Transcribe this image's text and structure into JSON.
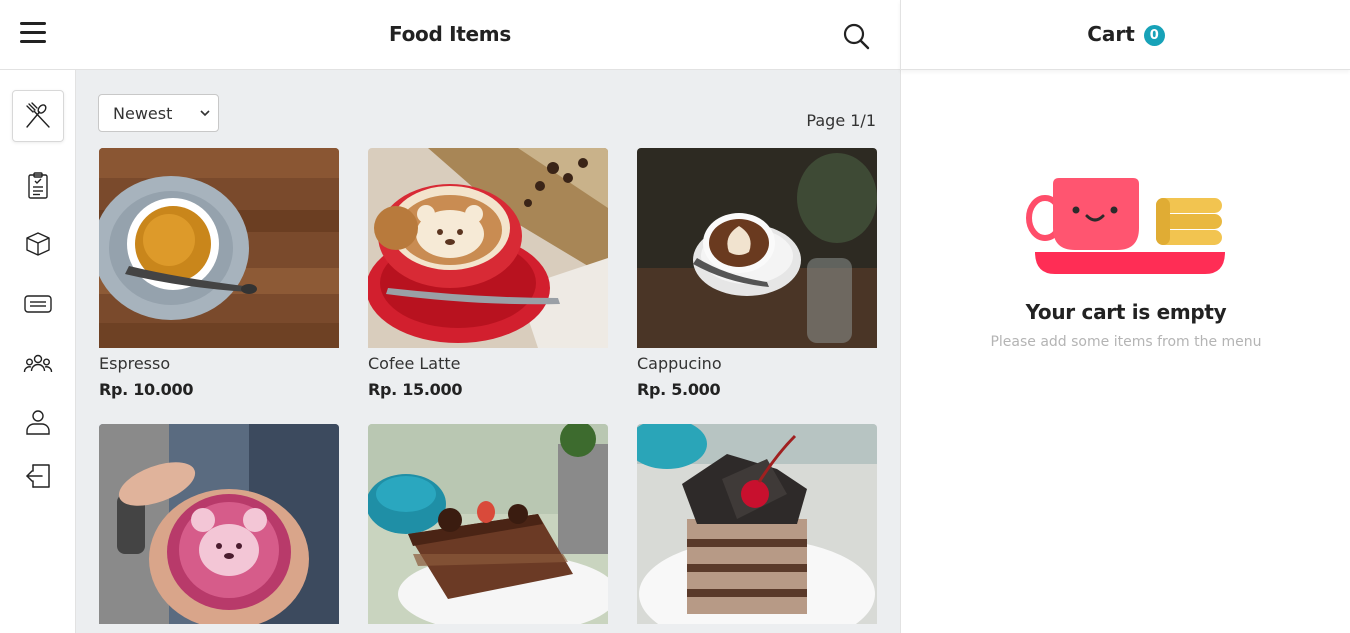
{
  "header": {
    "title": "Food Items",
    "menu_icon": "hamburger-icon",
    "search_icon": "search-icon"
  },
  "cart_header": {
    "title": "Cart",
    "count": "0",
    "badge_color": "#17a2b8"
  },
  "sidebar": {
    "items": [
      {
        "icon": "utensils-icon",
        "active": true
      },
      {
        "icon": "clipboard-icon",
        "active": false
      },
      {
        "icon": "box-icon",
        "active": false
      },
      {
        "icon": "card-icon",
        "active": false
      },
      {
        "icon": "users-icon",
        "active": false
      },
      {
        "icon": "user-icon",
        "active": false
      },
      {
        "icon": "logout-icon",
        "active": false
      }
    ]
  },
  "toolbar": {
    "sort_value": "Newest",
    "page_info": "Page 1/1"
  },
  "products": [
    {
      "name": "Espresso",
      "price": "Rp. 10.000"
    },
    {
      "name": "Cofee Latte",
      "price": "Rp. 15.000"
    },
    {
      "name": "Cappucino",
      "price": "Rp. 5.000"
    },
    {
      "name": "",
      "price": ""
    },
    {
      "name": "",
      "price": ""
    },
    {
      "name": "",
      "price": ""
    }
  ],
  "cart": {
    "empty_title": "Your cart is empty",
    "empty_subtitle": "Please add some items from the menu",
    "illustration_icon": "empty-cart-cup-icon"
  },
  "colors": {
    "accent": "#17a2b8",
    "cup": "#ff4d6a",
    "plate": "#ff2d55",
    "cookies": "#f2c450"
  }
}
